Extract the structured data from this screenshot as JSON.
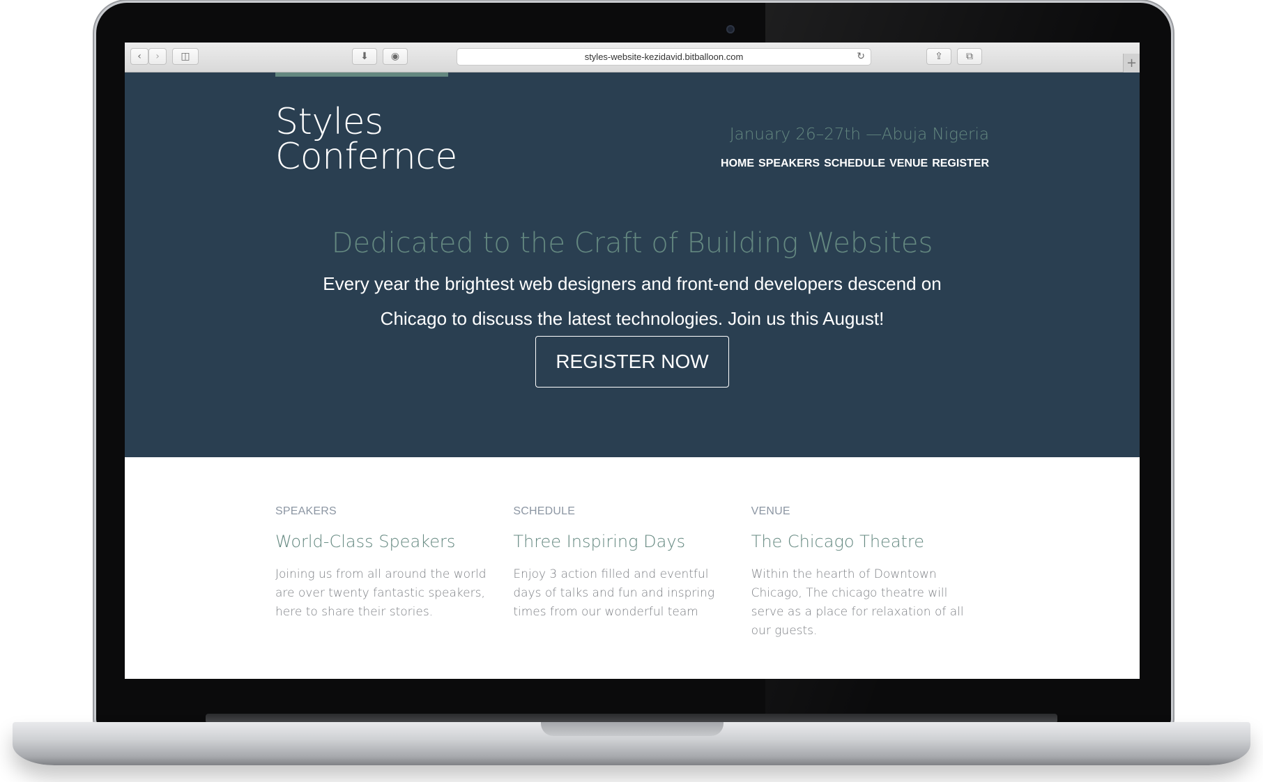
{
  "browser": {
    "url": "styles-website-kezidavid.bitballoon.com",
    "back_icon": "chevron-left-icon",
    "forward_icon": "chevron-right-icon",
    "sidebar_icon": "sidebar-icon",
    "download_icon": "download-icon",
    "shield_icon": "shield-icon",
    "reload_icon": "reload-icon",
    "share_icon": "share-icon",
    "tabs_icon": "tabs-icon",
    "new_tab_icon": "plus-icon"
  },
  "header": {
    "logo_line1": "Styles",
    "logo_line2": "Confernce",
    "event_date": "January 26–27th —Abuja Nigeria",
    "nav": [
      "HOME",
      "SPEAKERS",
      "SCHEDULE",
      "VENUE",
      "REGISTER"
    ]
  },
  "hero": {
    "title": "Dedicated to the Craft of Building Websites",
    "text": "Every year the brightest web designers and front-end developers descend on Chicago to discuss the latest technologies. Join us this August!",
    "button": "REGISTER NOW"
  },
  "features": [
    {
      "label": "SPEAKERS",
      "title": "World-Class Speakers",
      "text": "Joining us from all around the world are over twenty fantastic speakers, here to share their stories."
    },
    {
      "label": "SCHEDULE",
      "title": "Three Inspiring Days",
      "text": "Enjoy 3 action filled and eventful days of talks and fun and inspring times from our wonderful team"
    },
    {
      "label": "VENUE",
      "title": "The Chicago Theatre",
      "text": "Within the hearth of Downtown Chicago, The chicago theatre will serve as a place for relaxation of all our guests."
    }
  ],
  "colors": {
    "hero_bg": "#2a3f51",
    "accent": "#648880",
    "feature_label": "#8c96a3",
    "body_text": "#7c7f84"
  }
}
